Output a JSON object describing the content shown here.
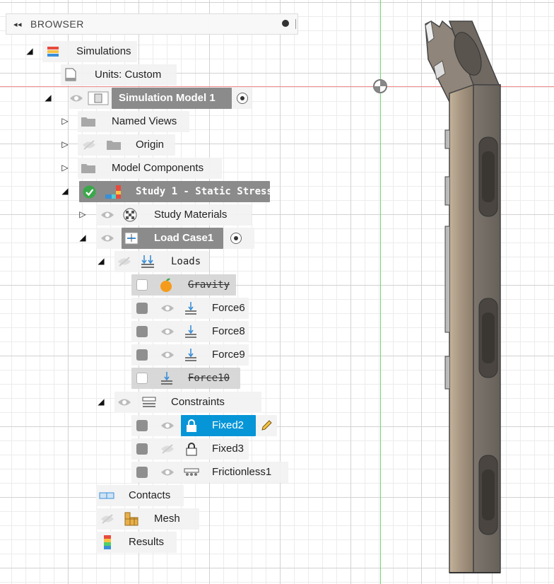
{
  "browser": {
    "title": "BROWSER",
    "collapse_glyph": "◂◂"
  },
  "tree": {
    "simulations": "Simulations",
    "units": "Units: Custom",
    "sim_model": "Simulation Model 1",
    "named_views": "Named Views",
    "origin": "Origin",
    "model_components": "Model Components",
    "study": "Study 1 - Static Stress",
    "study_materials": "Study Materials",
    "load_case": "Load Case1",
    "loads": "Loads",
    "gravity": "Gravity",
    "force6": "Force6",
    "force8": "Force8",
    "force9": "Force9",
    "force10": "Force10",
    "constraints": "Constraints",
    "fixed2": "Fixed2",
    "fixed3": "Fixed3",
    "frictionless1": "Frictionless1",
    "contacts": "Contacts",
    "mesh": "Mesh",
    "results": "Results"
  },
  "state": {
    "gravity_checked": false,
    "force6_checked": true,
    "force8_checked": true,
    "force9_checked": true,
    "force10_checked": false,
    "fixed2_checked": true,
    "fixed3_checked": true,
    "frictionless1_checked": true,
    "selected_item": "Fixed2",
    "study_status": "ok"
  },
  "colors": {
    "selection": "#0696d7",
    "status_ok": "#3aa84a",
    "highlight_row": "#8b8b8b",
    "x_axis": "#f08a8a",
    "y_axis": "#6fd66f"
  },
  "icons": {
    "visibility": "eye-icon",
    "hidden": "eye-slash-icon",
    "folder": "folder-icon",
    "document": "document-icon",
    "load": "force-arrow-icon",
    "constraint_fixed": "lock-icon",
    "edit": "pencil-icon"
  }
}
